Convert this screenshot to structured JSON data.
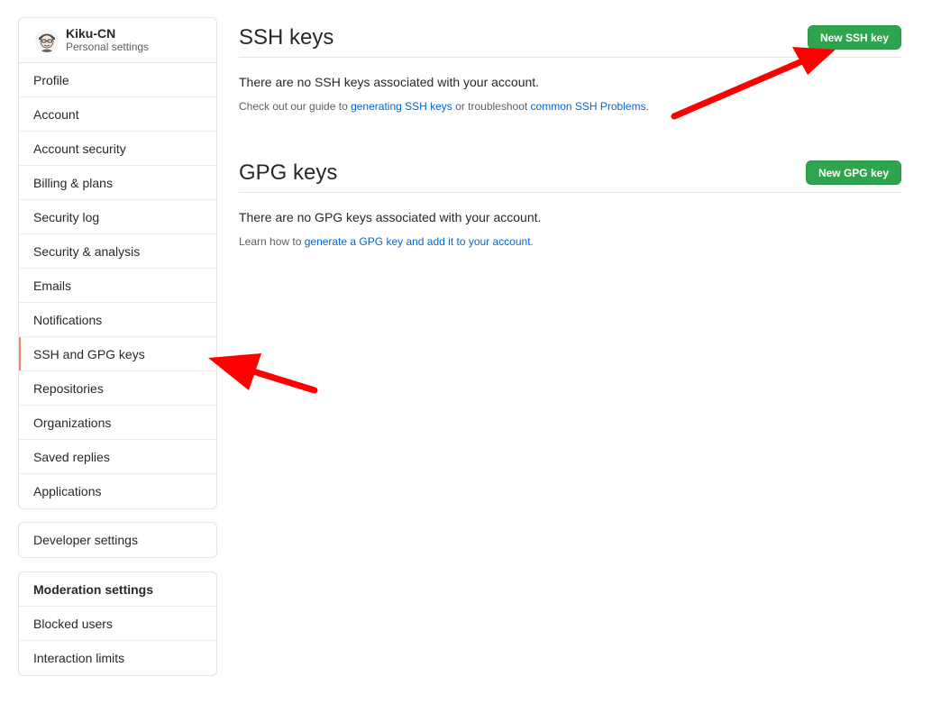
{
  "user": {
    "name": "Kiku-CN",
    "subtitle": "Personal settings"
  },
  "sidebar": {
    "items": [
      {
        "label": "Profile"
      },
      {
        "label": "Account"
      },
      {
        "label": "Account security"
      },
      {
        "label": "Billing & plans"
      },
      {
        "label": "Security log"
      },
      {
        "label": "Security & analysis"
      },
      {
        "label": "Emails"
      },
      {
        "label": "Notifications"
      },
      {
        "label": "SSH and GPG keys",
        "selected": true
      },
      {
        "label": "Repositories"
      },
      {
        "label": "Organizations"
      },
      {
        "label": "Saved replies"
      },
      {
        "label": "Applications"
      }
    ],
    "developer": {
      "label": "Developer settings"
    },
    "moderation": {
      "heading": "Moderation settings",
      "items": [
        {
          "label": "Blocked users"
        },
        {
          "label": "Interaction limits"
        }
      ]
    }
  },
  "ssh": {
    "title": "SSH keys",
    "button": "New SSH key",
    "empty": "There are no SSH keys associated with your account.",
    "help_prefix": "Check out our guide to ",
    "help_link1": "generating SSH keys",
    "help_middle": " or troubleshoot ",
    "help_link2": "common SSH Problems",
    "help_suffix": "."
  },
  "gpg": {
    "title": "GPG keys",
    "button": "New GPG key",
    "empty": "There are no GPG keys associated with your account.",
    "help_prefix": "Learn how to ",
    "help_link": "generate a GPG key and add it to your account",
    "help_suffix": "."
  },
  "colors": {
    "accent_green": "#2ea44f",
    "link_blue": "#0366d6",
    "selected_marker": "#f9826c",
    "annotation_arrow": "#ff0000"
  },
  "icons": {
    "avatar": "user-avatar-icon",
    "annotation": "red-arrow-icon"
  }
}
